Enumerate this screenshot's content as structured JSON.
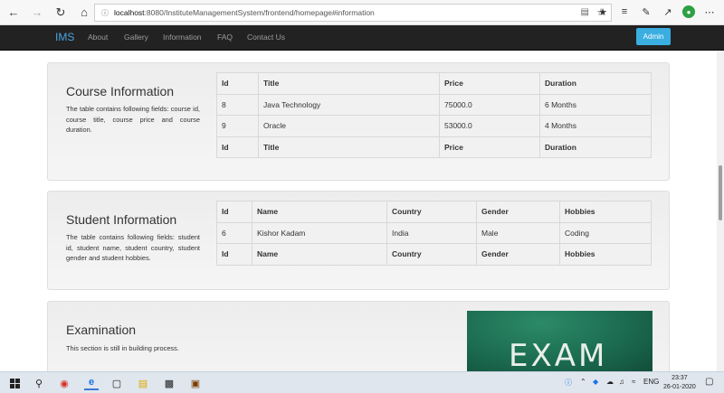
{
  "browser": {
    "url_host": "localhost",
    "url_path": ":8080/InstituteManagementSystem/frontend/homepage#information"
  },
  "navbar": {
    "brand": "IMS",
    "links": [
      "About",
      "Gallery",
      "Information",
      "FAQ",
      "Contact Us"
    ],
    "admin_label": "Admin"
  },
  "course": {
    "title": "Course Information",
    "description": "The table contains following fields: course id, course title, course price and course duration.",
    "headers": [
      "Id",
      "Title",
      "Price",
      "Duration"
    ],
    "rows": [
      [
        "8",
        "Java Technology",
        "75000.0",
        "6 Months"
      ],
      [
        "9",
        "Oracle",
        "53000.0",
        "4 Months"
      ]
    ]
  },
  "student": {
    "title": "Student Information",
    "description": "The table contains following fields: student id, student name, student country, student gender and student hobbies.",
    "headers": [
      "Id",
      "Name",
      "Country",
      "Gender",
      "Hobbies"
    ],
    "rows": [
      [
        "6",
        "Kishor Kadam",
        "India",
        "Male",
        "Coding"
      ]
    ]
  },
  "exam": {
    "title": "Examination",
    "description": "This section is still in building process.",
    "image_text": "EXAM"
  },
  "taskbar": {
    "language": "ENG",
    "time": "23:37",
    "date": "26-01-2020"
  }
}
